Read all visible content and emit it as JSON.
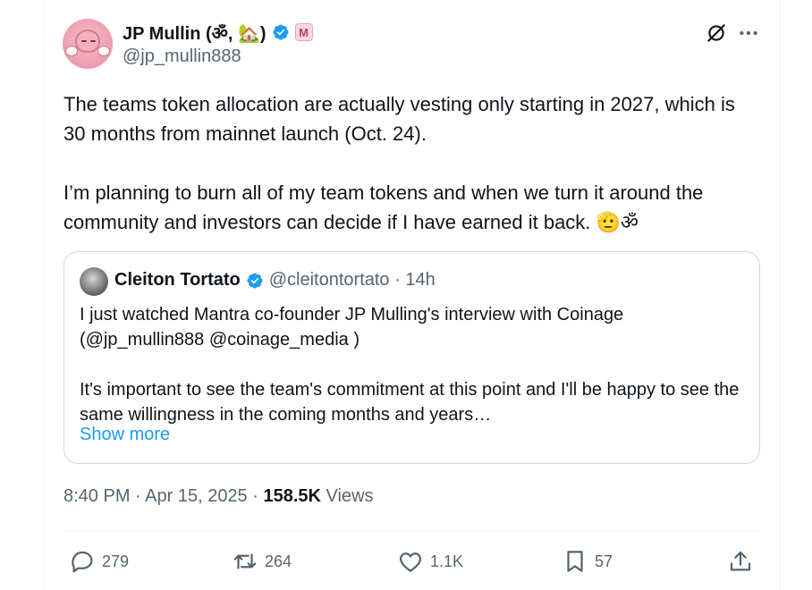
{
  "author": {
    "name": "JP Mullin (ॐ, 🏡)",
    "handle": "@jp_mullin888",
    "affiliate_badge": "M"
  },
  "tweet": {
    "text": "The teams token allocation are actually vesting only starting in 2027, which is 30 months from mainnet launch (Oct. 24).\n\nI’m planning to burn all of my team tokens and when we turn it around the community and investors can decide if I have earned it back. 🫡ॐ"
  },
  "quote": {
    "name": "Cleiton Tortato",
    "meta": "@cleitontortato · 14h",
    "text": "I just watched Mantra co-founder JP Mulling's interview with Coinage (@jp_mullin888 @coinage_media )\n\nIt's important to see the team's commitment at this point and I'll be happy to see the same willingness in the coming months and years…",
    "show_more": "Show more"
  },
  "meta": {
    "timestamp": "8:40 PM · Apr 15, 2025 · ",
    "views_count": "158.5K",
    "views_label": " Views"
  },
  "actions": {
    "replies": "279",
    "reposts": "264",
    "likes": "1.1K",
    "bookmarks": "57"
  },
  "colors": {
    "text": "#0f1419",
    "secondary": "#536471",
    "accent": "#1d9bf0",
    "border": "#cfd9de"
  },
  "icons": [
    "verified-badge-icon",
    "grok-icon",
    "more-icon",
    "reply-icon",
    "repost-icon",
    "like-icon",
    "bookmark-icon",
    "share-icon"
  ]
}
